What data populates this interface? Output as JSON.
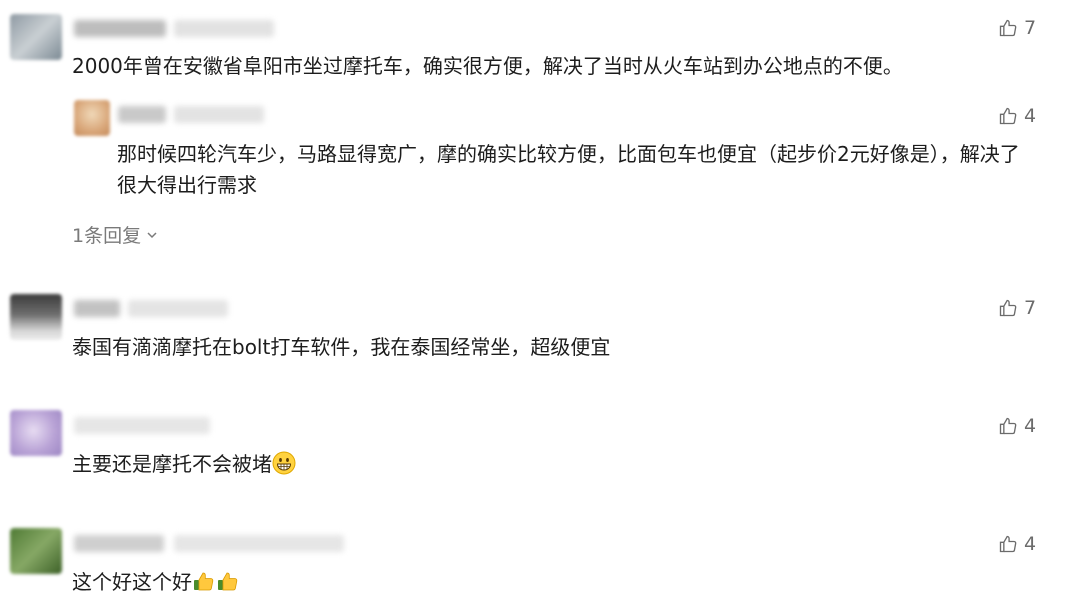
{
  "comments": [
    {
      "text": "2000年曾在安徽省阜阳市坐过摩托车，确实很方便，解决了当时从火车站到办公地点的不便。",
      "likes": "7",
      "reply": {
        "text": "那时候四轮汽车少，马路显得宽广，摩的确实比较方便，比面包车也便宜（起步价2元好像是），解决了很大得出行需求",
        "likes": "4"
      },
      "replies_toggle": "1条回复"
    },
    {
      "text": "泰国有滴滴摩托在bolt打车软件，我在泰国经常坐，超级便宜",
      "likes": "7"
    },
    {
      "text": "主要还是摩托不会被堵",
      "likes": "4",
      "emoji": "grinning-face-emoji"
    },
    {
      "text": "这个好这个好",
      "likes": "4",
      "emoji": "thumbs-up-emoji"
    }
  ]
}
